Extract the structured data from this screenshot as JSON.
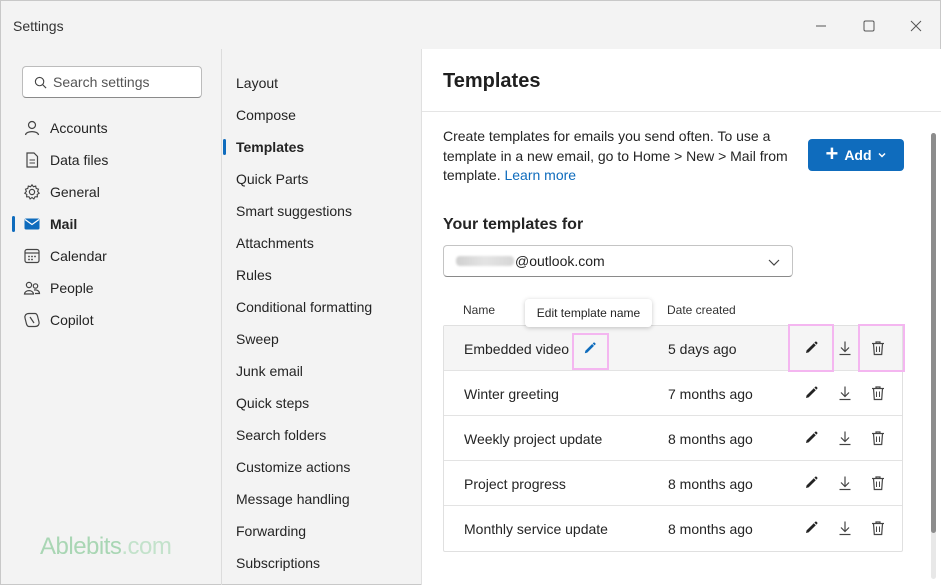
{
  "window": {
    "title": "Settings"
  },
  "search": {
    "placeholder": "Search settings"
  },
  "nav": [
    {
      "label": "Accounts",
      "icon": "person-icon"
    },
    {
      "label": "Data files",
      "icon": "document-icon"
    },
    {
      "label": "General",
      "icon": "gear-icon"
    },
    {
      "label": "Mail",
      "icon": "mail-icon",
      "active": true
    },
    {
      "label": "Calendar",
      "icon": "calendar-icon"
    },
    {
      "label": "People",
      "icon": "people-icon"
    },
    {
      "label": "Copilot",
      "icon": "copilot-icon"
    }
  ],
  "brand": {
    "name": "Ablebits",
    "suffix": ".com"
  },
  "submenu": [
    "Layout",
    "Compose",
    "Templates",
    "Quick Parts",
    "Smart suggestions",
    "Attachments",
    "Rules",
    "Conditional formatting",
    "Sweep",
    "Junk email",
    "Quick steps",
    "Search folders",
    "Customize actions",
    "Message handling",
    "Forwarding",
    "Subscriptions"
  ],
  "submenu_active": "Templates",
  "main": {
    "title": "Templates",
    "description": "Create templates for emails you send often. To use a template in a new email, go to Home > New > Mail from template.",
    "learn_more": "Learn more",
    "add_label": "Add",
    "your_templates_label": "Your templates for",
    "account_suffix": "@outlook.com",
    "columns": {
      "name": "Name",
      "date": "Date created"
    },
    "tooltip": "Edit template name",
    "templates": [
      {
        "name": "Embedded video",
        "date": "5 days ago"
      },
      {
        "name": "Winter greeting",
        "date": "7 months ago"
      },
      {
        "name": "Weekly project update",
        "date": "8 months ago"
      },
      {
        "name": "Project progress",
        "date": "8 months ago"
      },
      {
        "name": "Monthly service update",
        "date": "8 months ago"
      }
    ]
  },
  "colors": {
    "accent": "#0f6cbd",
    "highlight": "#f4b6f0",
    "brand": "#a9d6b4"
  }
}
